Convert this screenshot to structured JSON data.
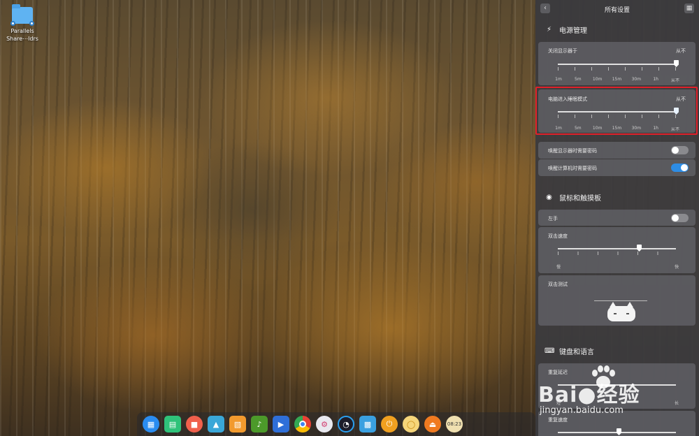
{
  "desktop": {
    "icon_label_line1": "Parallels",
    "icon_label_line2": "Share⋯ldrs"
  },
  "panel": {
    "title": "所有设置",
    "power": {
      "section_title": "电源管理",
      "display_off_label": "关闭显示器于",
      "display_off_value": "从不",
      "sleep_label": "电脑进入睡眠模式",
      "sleep_value": "从不",
      "ticks": [
        "1m",
        "5m",
        "10m",
        "15m",
        "30m",
        "1h",
        "从不"
      ],
      "wake_display_pwd": "唤醒显示器时需要密码",
      "wake_display_pwd_on": false,
      "wake_computer_pwd": "唤醒计算机时需要密码",
      "wake_computer_pwd_on": true
    },
    "mouse": {
      "section_title": "鼠标和触摸板",
      "left_hand": "左手",
      "left_hand_on": false,
      "double_click_speed": "双击速度",
      "slow": "慢",
      "fast": "快",
      "double_click_test": "双击测试"
    },
    "keyboard": {
      "section_title": "键盘和语言",
      "repeat_delay": "重复延迟",
      "short": "短",
      "long": "长",
      "repeat_speed": "重复速度"
    }
  },
  "dock": {
    "clock_text": "08:23"
  },
  "watermark": {
    "brand": "Bai●经验",
    "url": "jingyan.baidu.com"
  },
  "colors": {
    "accent": "#2d8de6",
    "highlight": "#e0202a"
  }
}
